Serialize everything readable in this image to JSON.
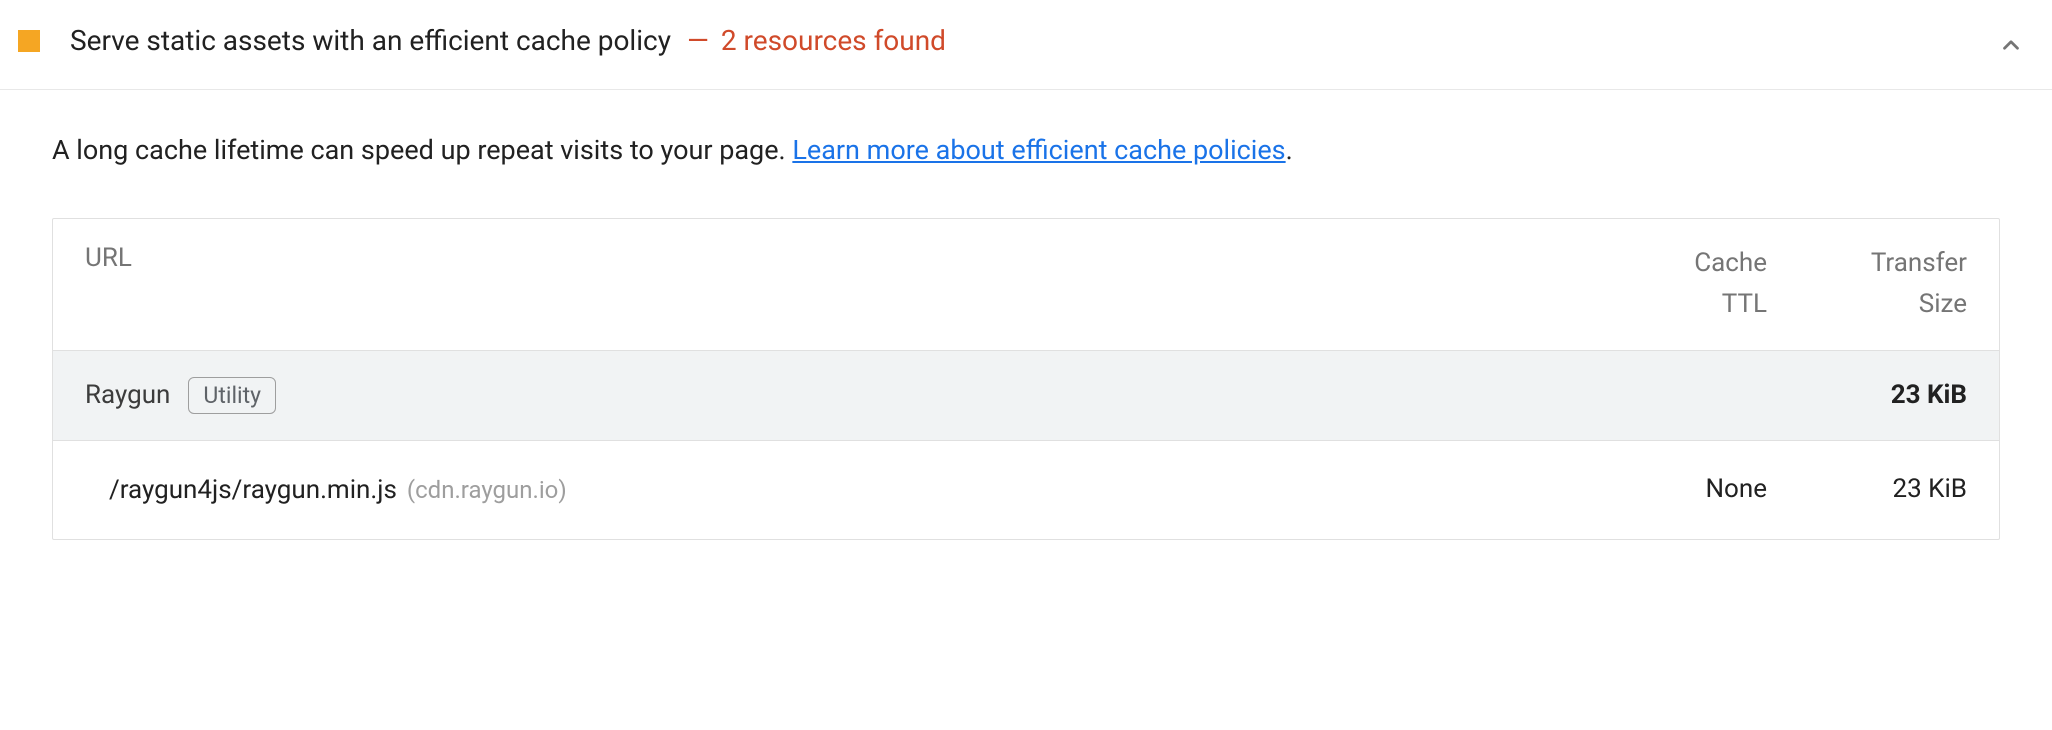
{
  "audit": {
    "title": "Serve static assets with an efficient cache policy",
    "summary": "2 resources found",
    "description_prefix": "A long cache lifetime can speed up repeat visits to your page. ",
    "learn_more_text": "Learn more about efficient cache policies",
    "description_suffix": "."
  },
  "table": {
    "headers": {
      "url": "URL",
      "cache_line1": "Cache",
      "cache_line2": "TTL",
      "size_line1": "Transfer",
      "size_line2": "Size"
    },
    "groups": [
      {
        "name": "Raygun",
        "badge": "Utility",
        "total_size": "23 KiB",
        "resources": [
          {
            "path": "/raygun4js/raygun.min.js",
            "host": "(cdn.raygun.io)",
            "cache_ttl": "None",
            "transfer_size": "23 KiB"
          }
        ]
      }
    ]
  }
}
